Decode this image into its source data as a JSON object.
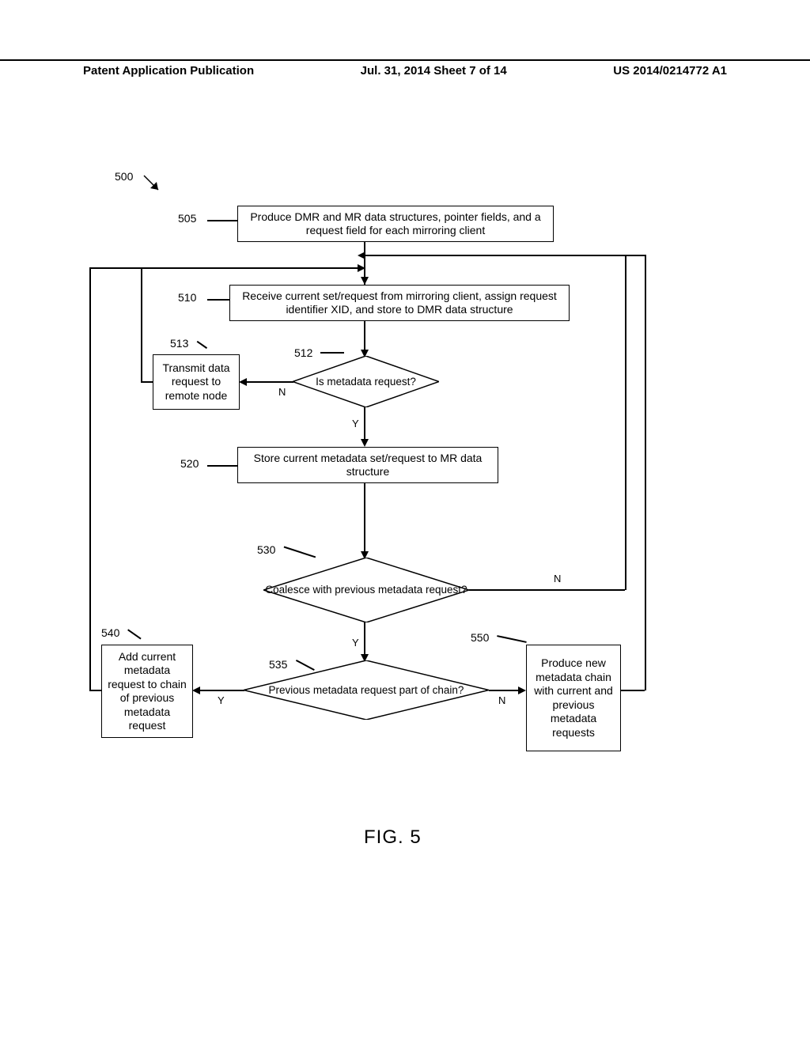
{
  "header": {
    "left": "Patent Application Publication",
    "mid": "Jul. 31, 2014  Sheet 7 of 14",
    "right": "US 2014/0214772 A1"
  },
  "labels": {
    "l500": "500",
    "l505": "505",
    "l510": "510",
    "l512": "512",
    "l513": "513",
    "l520": "520",
    "l530": "530",
    "l535": "535",
    "l540": "540",
    "l550": "550"
  },
  "boxes": {
    "b505": "Produce DMR and MR data structures, pointer fields, and a request field for each mirroring client",
    "b510": "Receive current set/request from mirroring client, assign request identifier XID, and store to DMR data structure",
    "b513": "Transmit data request to remote node",
    "b520": "Store current metadata set/request to MR data structure",
    "b540": "Add current metadata request to chain of previous metadata request",
    "b550": "Produce new metadata chain with current and previous metadata requests"
  },
  "diamonds": {
    "d512": "Is metadata request?",
    "d530": "Coalesce with previous metadata request?",
    "d535": "Previous metadata request part of chain?"
  },
  "yn": {
    "Y": "Y",
    "N": "N"
  },
  "figure": "FIG. 5"
}
